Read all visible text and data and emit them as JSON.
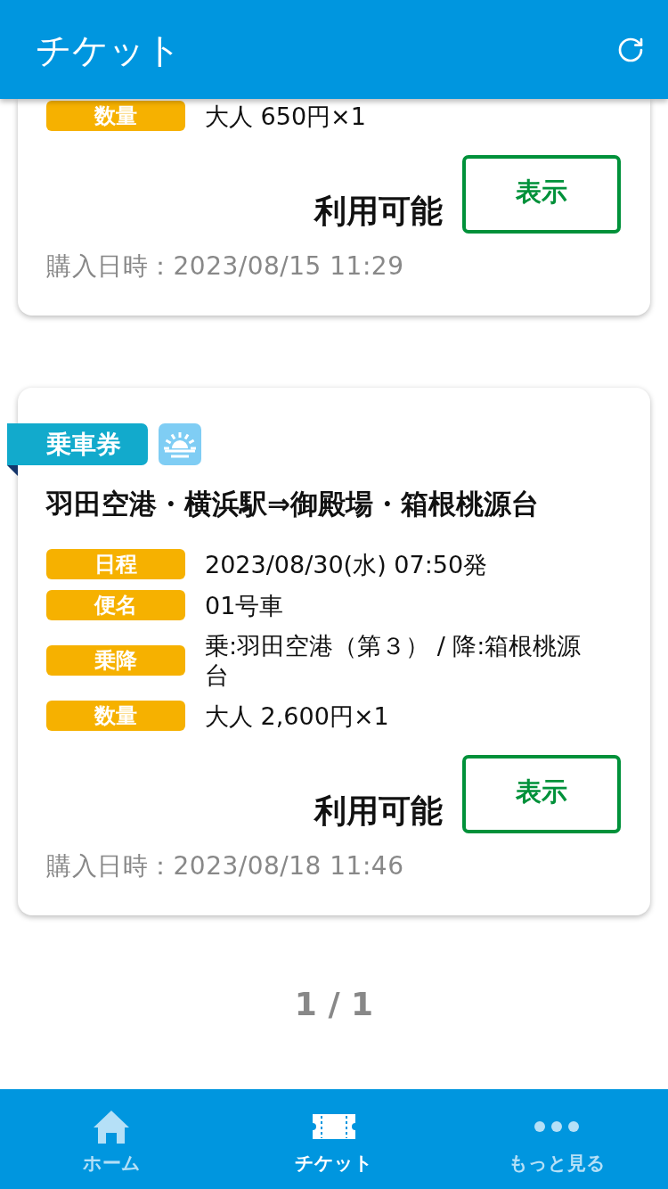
{
  "header": {
    "title": "チケット"
  },
  "tickets": [
    {
      "details": [
        {
          "label": "数量",
          "value": "大人 650円×1"
        }
      ],
      "status": "利用可能",
      "action": "表示",
      "purchased": "購入日時：2023/08/15 11:29"
    },
    {
      "tag": "乗車券",
      "title": "羽田空港・横浜駅⇒御殿場・箱根桃源台",
      "details": [
        {
          "label": "日程",
          "value": "2023/08/30(水) 07:50発"
        },
        {
          "label": "便名",
          "value": "01号車"
        },
        {
          "label": "乗降",
          "value": "乗:羽田空港（第３） / 降:箱根桃源台"
        },
        {
          "label": "数量",
          "value": "大人 2,600円×1"
        }
      ],
      "status": "利用可能",
      "action": "表示",
      "purchased": "購入日時：2023/08/18 11:46"
    }
  ],
  "pagination": "1 / 1",
  "nav": [
    {
      "kind": "home",
      "label": "ホーム",
      "selected": false
    },
    {
      "kind": "ticket",
      "label": "チケット",
      "selected": true
    },
    {
      "kind": "more",
      "label": "もっと見る",
      "selected": false
    }
  ]
}
